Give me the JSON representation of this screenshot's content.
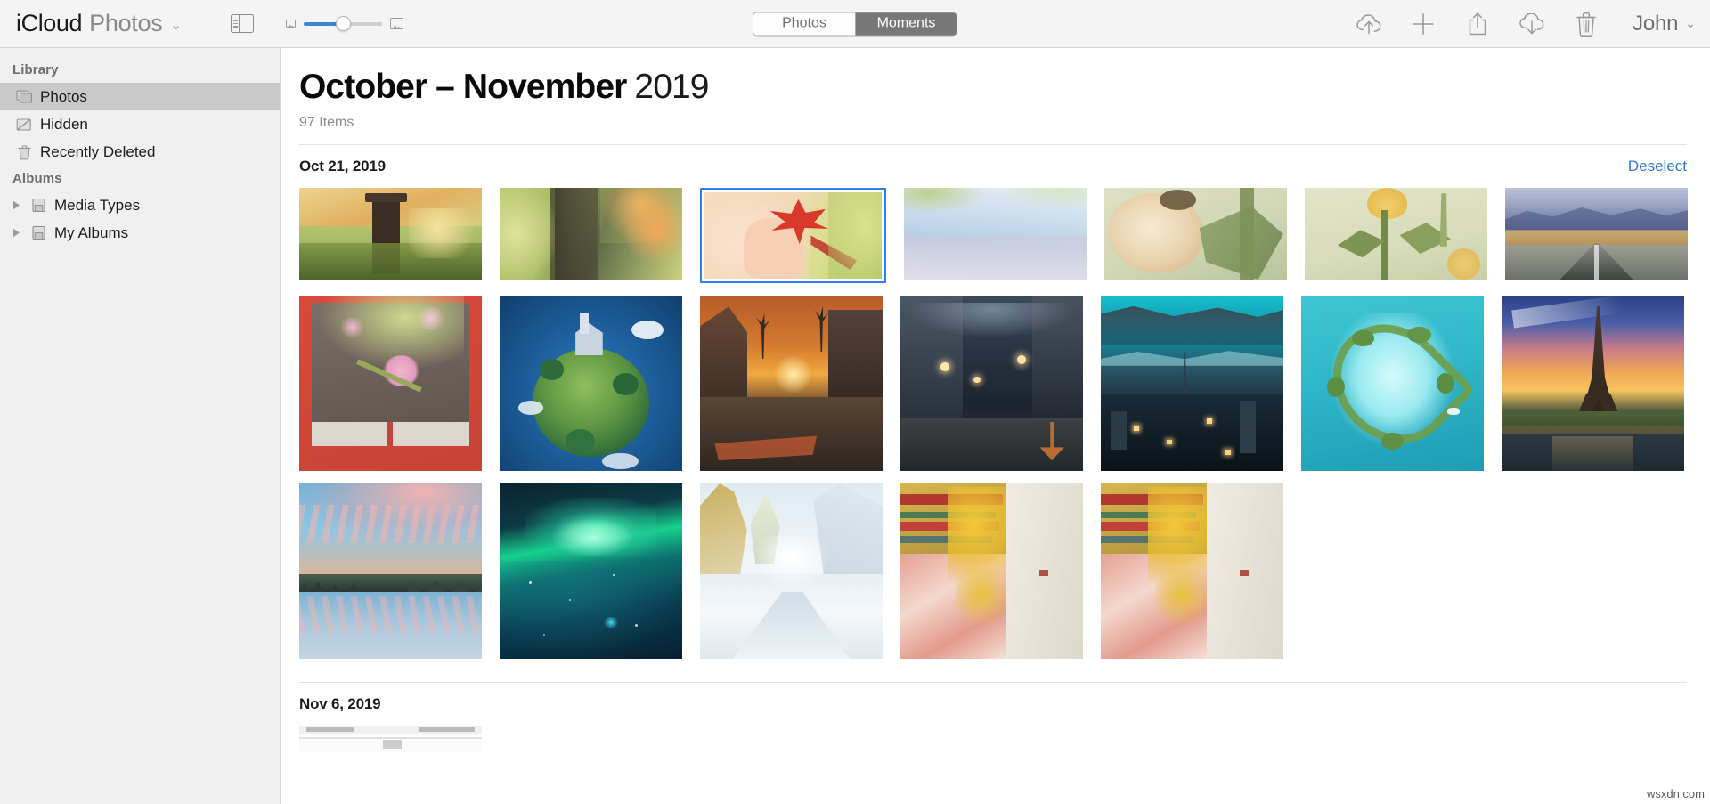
{
  "toolbar": {
    "brand_primary": "iCloud",
    "brand_secondary": "Photos",
    "brand_chevron": "⌄",
    "sidebar_toggle_icon": "sidebar-toggle-icon",
    "zoom": {
      "small_icon": "small-thumbnail-icon",
      "large_icon": "large-thumbnail-icon",
      "value_percent": 50
    },
    "segments": [
      {
        "label": "Photos",
        "active": false
      },
      {
        "label": "Moments",
        "active": true
      }
    ],
    "actions": [
      {
        "name": "cloud-upload-icon",
        "title": "Upload"
      },
      {
        "name": "plus-icon",
        "title": "Add"
      },
      {
        "name": "share-icon",
        "title": "Share"
      },
      {
        "name": "cloud-download-icon",
        "title": "Download"
      },
      {
        "name": "trash-icon",
        "title": "Delete"
      }
    ],
    "account_name": "John",
    "account_chevron": "⌄"
  },
  "sidebar": {
    "sections": [
      {
        "header": "Library",
        "items": [
          {
            "label": "Photos",
            "icon": "photos-stack-icon",
            "selected": true,
            "disclosure": false
          },
          {
            "label": "Hidden",
            "icon": "hidden-slash-icon",
            "selected": false,
            "disclosure": false
          },
          {
            "label": "Recently Deleted",
            "icon": "trash-icon",
            "selected": false,
            "disclosure": false
          }
        ]
      },
      {
        "header": "Albums",
        "items": [
          {
            "label": "Media Types",
            "icon": "album-folder-icon",
            "selected": false,
            "disclosure": true
          },
          {
            "label": "My Albums",
            "icon": "album-folder-icon",
            "selected": false,
            "disclosure": true
          }
        ]
      }
    ]
  },
  "main": {
    "title_range": "October – November",
    "title_year": "2019",
    "item_count": "97 Items",
    "groups": [
      {
        "date": "Oct 21, 2019",
        "action_label": "Deselect",
        "rows": [
          {
            "orientation": "landscape",
            "photos": [
              {
                "alt": "wooden post with autumn foliage",
                "selected": false,
                "style": "autumn-post"
              },
              {
                "alt": "autumn leaves on tree trunk",
                "selected": false,
                "style": "autumn-tree"
              },
              {
                "alt": "red maple leaf in hand",
                "selected": true,
                "style": "maple-hand"
              },
              {
                "alt": "pastel sky with clouds",
                "selected": false,
                "style": "pastel-sky"
              },
              {
                "alt": "wilted cream rose",
                "selected": false,
                "style": "wilted-rose"
              },
              {
                "alt": "yellow rose with green leaves",
                "selected": false,
                "style": "yellow-rose"
              },
              {
                "alt": "desert highway and mountains",
                "selected": false,
                "style": "desert-road"
              }
            ]
          },
          {
            "orientation": "portrait",
            "photos": [
              {
                "alt": "cherry blossom on red wall",
                "selected": false,
                "style": "blossom-wall"
              },
              {
                "alt": "tiny planet with castle",
                "selected": false,
                "style": "tiny-planet"
              },
              {
                "alt": "sunset street with stop marking",
                "selected": false,
                "style": "sunset-street"
              },
              {
                "alt": "night city street",
                "selected": false,
                "style": "night-street"
              },
              {
                "alt": "teal city skyline at dusk",
                "selected": false,
                "style": "teal-city"
              },
              {
                "alt": "heart shaped island in turquoise sea",
                "selected": false,
                "style": "heart-island"
              },
              {
                "alt": "eiffel tower at sunset",
                "selected": false,
                "style": "eiffel"
              }
            ]
          },
          {
            "orientation": "portrait",
            "photos": [
              {
                "alt": "pink clouds reflected in lake",
                "selected": false,
                "style": "lake-clouds"
              },
              {
                "alt": "green aurora in night sky",
                "selected": false,
                "style": "aurora"
              },
              {
                "alt": "snowy forest path",
                "selected": false,
                "style": "snow-forest"
              },
              {
                "alt": "yellow ginkgo leaves by temple wall",
                "selected": false,
                "style": "ginkgo"
              },
              {
                "alt": "yellow ginkgo leaves by temple wall",
                "selected": false,
                "style": "ginkgo"
              }
            ]
          }
        ]
      },
      {
        "date": "Nov 6, 2019",
        "action_label": "",
        "rows": [
          {
            "orientation": "partial",
            "photos": [
              {
                "alt": "device screenshot partially visible",
                "selected": false,
                "style": "partial-shot"
              }
            ]
          }
        ]
      }
    ]
  },
  "watermark": "wsxdn.com"
}
